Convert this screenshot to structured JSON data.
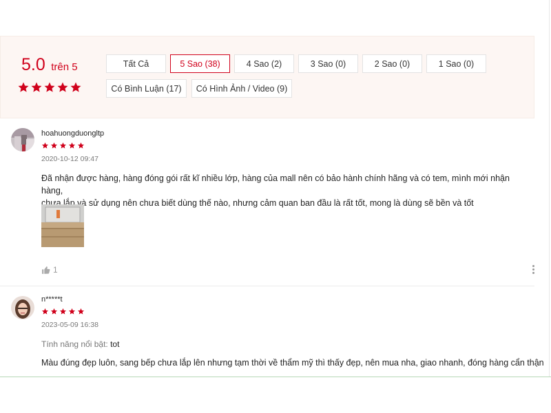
{
  "summary": {
    "score": "5.0",
    "score_suffix": "trên 5",
    "filters": [
      "Tất Cả",
      "5 Sao (38)",
      "4 Sao (2)",
      "3 Sao (0)",
      "2 Sao (0)",
      "1 Sao (0)",
      "Có Bình Luận (17)",
      "Có Hình Ảnh / Video (9)"
    ],
    "active_filter": "5 Sao (38)",
    "rating": 5
  },
  "reviews": [
    {
      "username": "hoahuongduongltp",
      "rating": 5,
      "date": "2020-10-12 09:47",
      "content_line1": "Đã nhận được hàng, hàng đóng gói rất kĩ nhiều lớp, hàng của mall nên có bảo hành chính hãng và có tem, mình mới nhận hàng,",
      "content_line2": "chưa lắp và sử dụng nên chưa biết dùng thế nào, nhưng cảm quan ban đầu là rất tốt, mong là dùng sẽ bền và tốt",
      "likes": "1"
    },
    {
      "username": "n*****t",
      "rating": 5,
      "date": "2023-05-09 16:38",
      "feature_label": "Tính năng nổi bật:",
      "feature_value": "tot",
      "content_line1": "Màu đúng đẹp luôn, sang bếp chưa lắp lên nhưng tạm thời về thẩm mỹ thì thấy đẹp, nên mua nha, giao nhanh, đóng hàng cẩn thận"
    }
  ],
  "colors": {
    "accent": "#d0011b",
    "panel_bg": "#fdf6f3"
  },
  "icons": {
    "star": "star-icon",
    "like": "thumbs-up-icon",
    "more": "more-vertical-icon"
  }
}
